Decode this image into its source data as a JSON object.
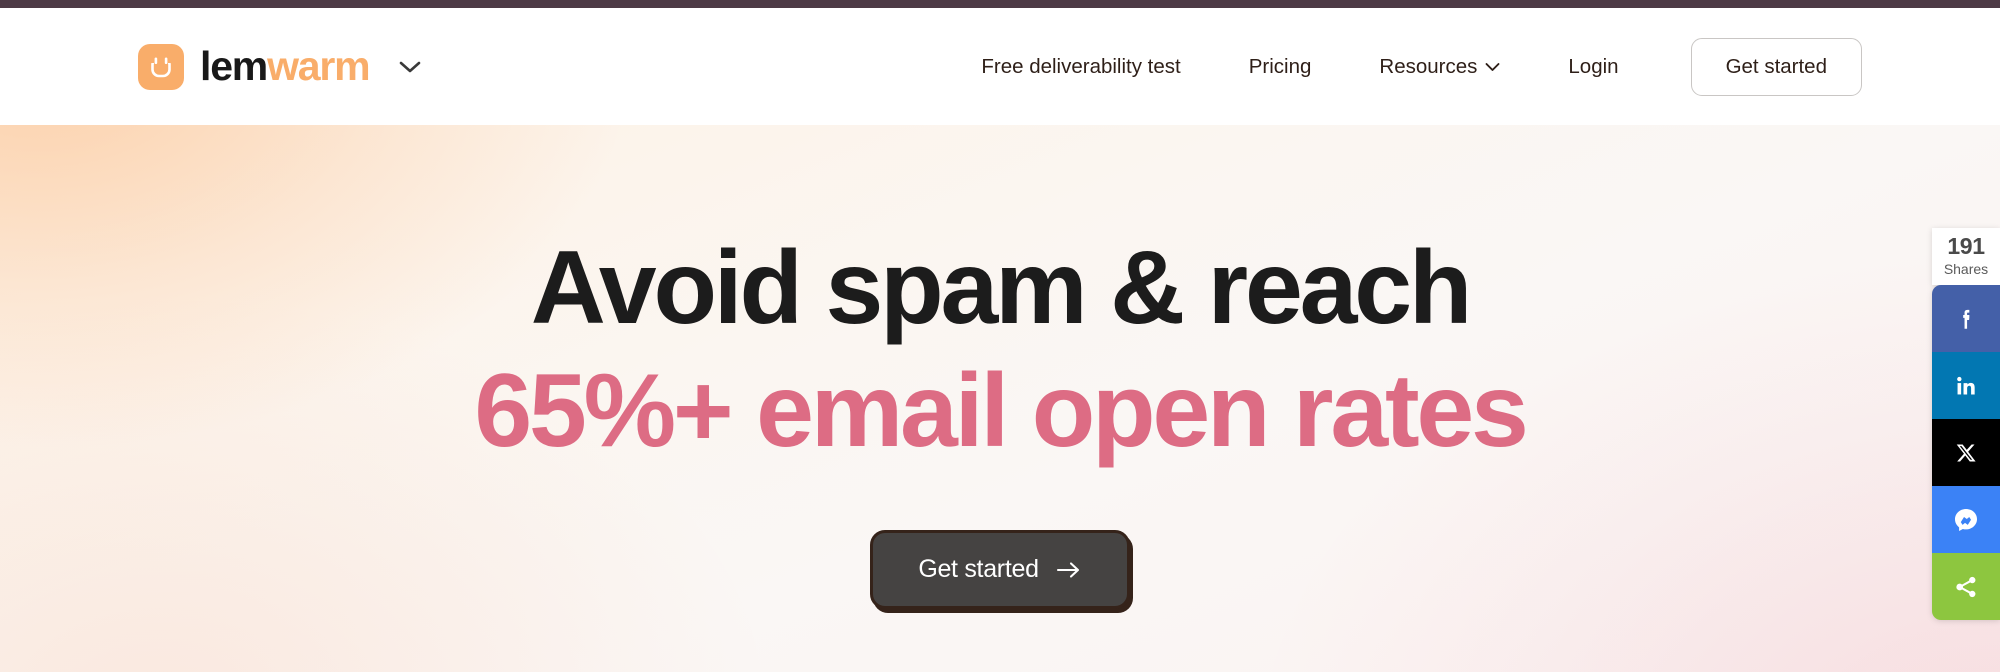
{
  "brand": {
    "logo_icon": "lemwarm-logo-icon",
    "name_first": "lem",
    "name_second": "warm",
    "chevron_icon": "chevron-down-icon",
    "logo_bg": "#f9ad6a"
  },
  "nav": {
    "links": [
      {
        "label": "Free deliverability test",
        "has_chevron": false
      },
      {
        "label": "Pricing",
        "has_chevron": false
      },
      {
        "label": "Resources",
        "has_chevron": true
      },
      {
        "label": "Login",
        "has_chevron": false
      }
    ],
    "cta_label": "Get started"
  },
  "hero": {
    "headline_line1": "Avoid spam & reach",
    "headline_line2": "65%+ email open rates",
    "headline_color_1": "#1c1c1c",
    "headline_color_2": "#dd6c84",
    "cta_label": "Get started",
    "cta_arrow_icon": "arrow-right-icon",
    "cta_bg": "#454342"
  },
  "share": {
    "count": "191",
    "count_label": "Shares",
    "buttons": [
      {
        "name": "facebook",
        "icon": "facebook-icon",
        "color": "#4460a8"
      },
      {
        "name": "linkedin",
        "icon": "linkedin-icon",
        "color": "#0277b2"
      },
      {
        "name": "x",
        "icon": "x-twitter-icon",
        "color": "#000000"
      },
      {
        "name": "messenger",
        "icon": "messenger-icon",
        "color": "#3b82f6"
      },
      {
        "name": "more",
        "icon": "share-nodes-icon",
        "color": "#8dc63f"
      }
    ]
  }
}
